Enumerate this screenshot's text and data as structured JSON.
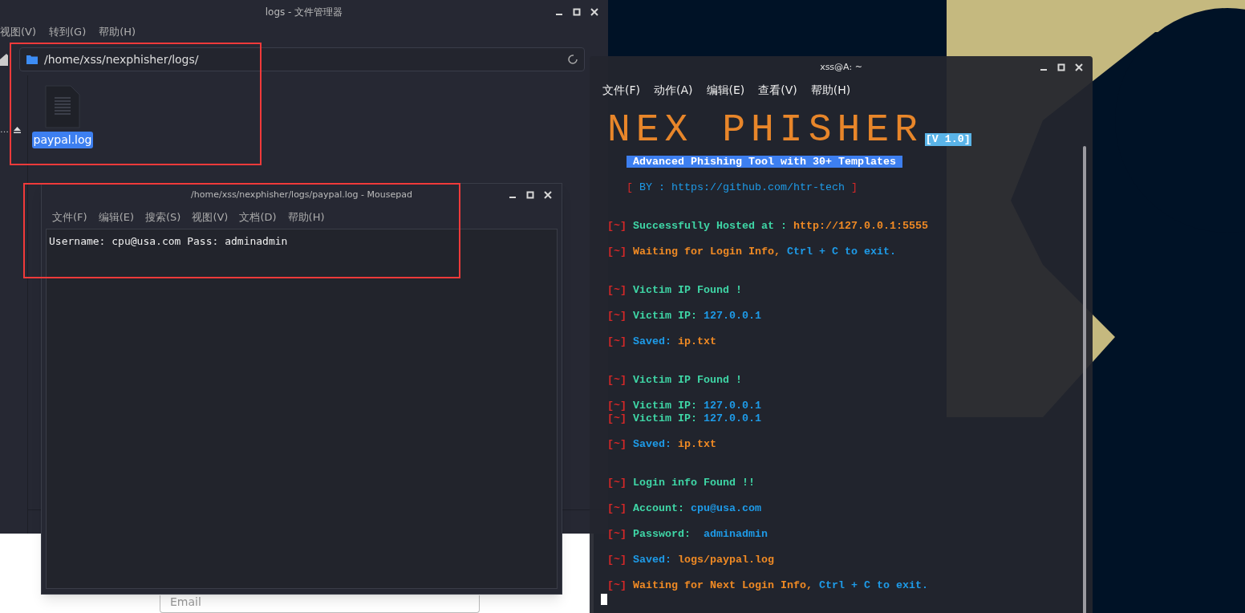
{
  "file_manager": {
    "title": "logs - 文件管理器",
    "menu": [
      "视图(V)",
      "转到(G)",
      "帮助(H)"
    ],
    "location": "/home/xss/nexphisher/logs/",
    "sidebar_label": "…",
    "files": [
      {
        "name": "paypal.log",
        "selected": true
      }
    ]
  },
  "browser_page": {
    "email_placeholder": "Email"
  },
  "editor": {
    "title": "/home/xss/nexphisher/logs/paypal.log - Mousepad",
    "menu": [
      "文件(F)",
      "编辑(E)",
      "搜索(S)",
      "视图(V)",
      "文档(D)",
      "帮助(H)"
    ],
    "content": "Username: cpu@usa.com Pass: adminadmin"
  },
  "terminal": {
    "title": "xss@A: ~",
    "menu": [
      "文件(F)",
      "动作(A)",
      "编辑(E)",
      "查看(V)",
      "帮助(H)"
    ],
    "banner": "NEX PHISHER",
    "version": "[V 1.0]",
    "tagline": "Advanced Phishing Tool with 30+ Templates",
    "credit": [
      {
        "text": "[",
        "kind": "bracket"
      },
      {
        "text": " BY : ",
        "kind": "value"
      },
      {
        "text": "https://github.com/htr-tech",
        "kind": "value"
      },
      {
        "text": " ]",
        "kind": "bracket"
      }
    ],
    "lines": [
      {
        "kind": "line",
        "prefix": "[~]",
        "parts": [
          {
            "text": "Successfully Hosted at : ",
            "kind": "label"
          },
          {
            "text": "http://127.0.0.1:5555",
            "kind": "warn"
          }
        ]
      },
      {
        "kind": "blank"
      },
      {
        "kind": "line",
        "prefix": "[~]",
        "parts": [
          {
            "text": "Waiting for Login Info, ",
            "kind": "warn"
          },
          {
            "text": "Ctrl + C to exit.",
            "kind": "value"
          }
        ]
      },
      {
        "kind": "blank"
      },
      {
        "kind": "blank"
      },
      {
        "kind": "line",
        "prefix": "[~]",
        "parts": [
          {
            "text": "Victim IP Found !",
            "kind": "label"
          }
        ]
      },
      {
        "kind": "blank"
      },
      {
        "kind": "line",
        "prefix": "[~]",
        "parts": [
          {
            "text": "Victim IP: ",
            "kind": "label"
          },
          {
            "text": "127.0.0.1",
            "kind": "value"
          }
        ]
      },
      {
        "kind": "blank"
      },
      {
        "kind": "line",
        "prefix": "[~]",
        "parts": [
          {
            "text": "Saved: ",
            "kind": "value"
          },
          {
            "text": "ip.txt",
            "kind": "warn"
          }
        ]
      },
      {
        "kind": "blank"
      },
      {
        "kind": "blank"
      },
      {
        "kind": "line",
        "prefix": "[~]",
        "parts": [
          {
            "text": "Victim IP Found !",
            "kind": "label"
          }
        ]
      },
      {
        "kind": "blank"
      },
      {
        "kind": "line",
        "prefix": "[~]",
        "parts": [
          {
            "text": "Victim IP: ",
            "kind": "label"
          },
          {
            "text": "127.0.0.1",
            "kind": "value"
          }
        ]
      },
      {
        "kind": "line",
        "prefix": "[~]",
        "parts": [
          {
            "text": "Victim IP: ",
            "kind": "label"
          },
          {
            "text": "127.0.0.1",
            "kind": "value"
          }
        ]
      },
      {
        "kind": "blank"
      },
      {
        "kind": "line",
        "prefix": "[~]",
        "parts": [
          {
            "text": "Saved: ",
            "kind": "value"
          },
          {
            "text": "ip.txt",
            "kind": "warn"
          }
        ]
      },
      {
        "kind": "blank"
      },
      {
        "kind": "blank"
      },
      {
        "kind": "line",
        "prefix": "[~]",
        "parts": [
          {
            "text": "Login info Found !!",
            "kind": "label"
          }
        ]
      },
      {
        "kind": "blank"
      },
      {
        "kind": "line",
        "prefix": "[~]",
        "parts": [
          {
            "text": "Account: ",
            "kind": "label"
          },
          {
            "text": "cpu@usa.com",
            "kind": "value"
          }
        ]
      },
      {
        "kind": "blank"
      },
      {
        "kind": "line",
        "prefix": "[~]",
        "parts": [
          {
            "text": "Password:  ",
            "kind": "label"
          },
          {
            "text": "adminadmin",
            "kind": "value"
          }
        ]
      },
      {
        "kind": "blank"
      },
      {
        "kind": "line",
        "prefix": "[~]",
        "parts": [
          {
            "text": "Saved: ",
            "kind": "value"
          },
          {
            "text": "logs/paypal.log",
            "kind": "warn"
          }
        ]
      },
      {
        "kind": "blank"
      },
      {
        "kind": "line",
        "prefix": "[~]",
        "parts": [
          {
            "text": "Waiting for Next Login Info, ",
            "kind": "warn"
          },
          {
            "text": "Ctrl + C to exit.",
            "kind": "value"
          }
        ]
      }
    ]
  }
}
